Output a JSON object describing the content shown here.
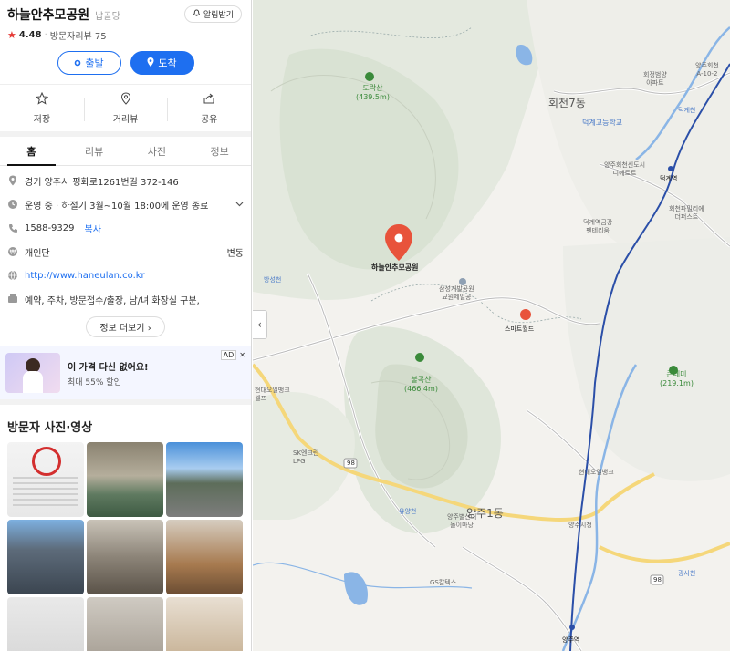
{
  "place": {
    "name": "하늘안추모공원",
    "category": "납골당",
    "share_label": "알림받기",
    "rating": "4.48",
    "review_label": "방문자리뷰 75",
    "depart_label": "출발",
    "arrive_label": "도착",
    "actions": [
      {
        "label": "저장",
        "icon": "star-outline-icon"
      },
      {
        "label": "거리뷰",
        "icon": "location-pin-icon"
      },
      {
        "label": "공유",
        "icon": "share-icon"
      }
    ],
    "tabs": [
      "홈",
      "리뷰",
      "사진",
      "정보"
    ],
    "active_tab": "홈"
  },
  "info": {
    "address": "경기 양주시 평화로1261번길 372-146",
    "hours": "운영 중 · 하절기 3월~10월 18:00에 운영 종료",
    "phone": "1588-9329",
    "copy_label": "복사",
    "price_label": "개인단",
    "price_value": "변동",
    "website": "http://www.haneulan.co.kr",
    "facilities": "예약, 주차, 방문접수/출장, 남/녀 화장실 구분,",
    "more_label": "정보 더보기"
  },
  "ad": {
    "title": "이 가격 다신 없어요!",
    "subtitle": "최대 55% 할인",
    "badge": "AD"
  },
  "photos": {
    "title": "방문자 사진·영상"
  },
  "map": {
    "pin_label": "하늘안추모공원",
    "labels": [
      {
        "text": "도락산",
        "sub": "(439.5m)",
        "kind": "mountain"
      },
      {
        "text": "불곡산",
        "sub": "(466.4m)",
        "kind": "mountain"
      },
      {
        "text": "큰테미",
        "sub": "(219.1m)",
        "kind": "mountain"
      },
      {
        "text": "회천7동",
        "kind": "district"
      },
      {
        "text": "양주1동",
        "kind": "district"
      },
      {
        "text": "덕계고등학교",
        "kind": "poi"
      },
      {
        "text": "회정범양",
        "sub": "아파트",
        "kind": "poi"
      },
      {
        "text": "양주회천",
        "sub": "A-10-2",
        "kind": "poi"
      },
      {
        "text": "덕계천",
        "kind": "poi"
      },
      {
        "text": "양주회천신도시",
        "sub": "디에트르",
        "kind": "poi"
      },
      {
        "text": "덕계역",
        "kind": "station"
      },
      {
        "text": "회천파밀리에",
        "sub": "더퍼스트",
        "kind": "poi"
      },
      {
        "text": "덕계역금강",
        "sub": "펜테리움",
        "kind": "poi"
      },
      {
        "text": "방성천",
        "kind": "poi"
      },
      {
        "text": "삼성개발공원",
        "sub": "묘원제일공",
        "kind": "poi"
      },
      {
        "text": "스마트월드",
        "kind": "poi"
      },
      {
        "text": "현대오일뱅크",
        "sub": "셀프",
        "kind": "poi"
      },
      {
        "text": "SK엔크린",
        "sub": "LPG",
        "kind": "poi"
      },
      {
        "text": "현대오일뱅크",
        "kind": "poi"
      },
      {
        "text": "유양천",
        "kind": "poi"
      },
      {
        "text": "양주별산대",
        "sub": "놀이마당",
        "kind": "poi"
      },
      {
        "text": "양주시청",
        "kind": "poi"
      },
      {
        "text": "GS칼텍스",
        "kind": "poi"
      },
      {
        "text": "광사천",
        "kind": "poi"
      },
      {
        "text": "양주역",
        "kind": "station"
      },
      {
        "text": "98",
        "kind": "road"
      },
      {
        "text": "98",
        "kind": "road"
      }
    ]
  },
  "colors": {
    "accent": "#1e6ff0",
    "pin": "#e8533b",
    "star": "#e53935",
    "mountain_label": "#3a8a3a",
    "river": "#8ab5e6",
    "road_yellow": "#f5d77a",
    "rail": "#2b4fa8"
  }
}
